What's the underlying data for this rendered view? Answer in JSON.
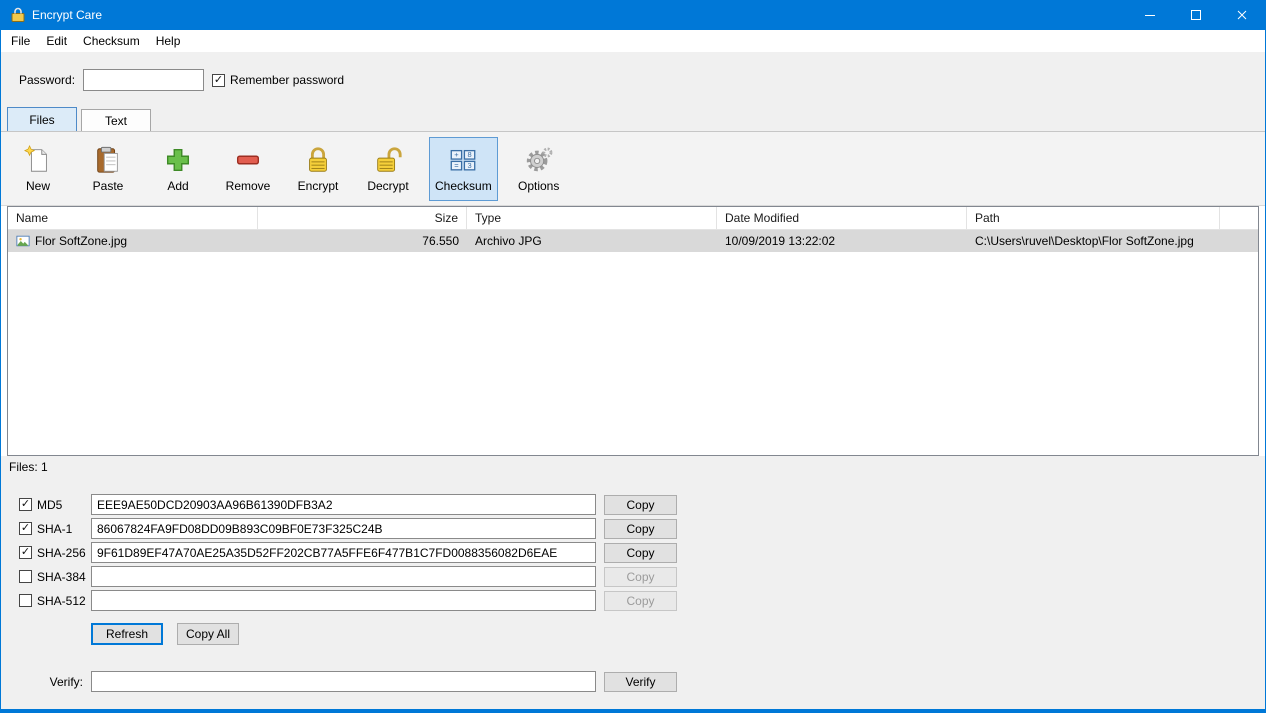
{
  "window": {
    "title": "Encrypt Care"
  },
  "menu": {
    "items": [
      "File",
      "Edit",
      "Checksum",
      "Help"
    ]
  },
  "password": {
    "label": "Password:",
    "value": "",
    "remember_label": "Remember password",
    "remember_checked": true
  },
  "tabs": [
    {
      "label": "Files",
      "active": true
    },
    {
      "label": "Text",
      "active": false
    }
  ],
  "toolbar": [
    {
      "label": "New",
      "icon": "new-document-icon",
      "selected": false
    },
    {
      "label": "Paste",
      "icon": "clipboard-paste-icon",
      "selected": false
    },
    {
      "label": "Add",
      "icon": "add-plus-icon",
      "selected": false
    },
    {
      "label": "Remove",
      "icon": "remove-minus-icon",
      "selected": false
    },
    {
      "label": "Encrypt",
      "icon": "lock-closed-icon",
      "selected": false
    },
    {
      "label": "Decrypt",
      "icon": "lock-open-icon",
      "selected": false
    },
    {
      "label": "Checksum",
      "icon": "checksum-grid-icon",
      "selected": true
    },
    {
      "label": "Options",
      "icon": "gear-icon",
      "selected": false
    }
  ],
  "file_table": {
    "columns": [
      "Name",
      "Size",
      "Type",
      "Date Modified",
      "Path"
    ],
    "rows": [
      {
        "name": "Flor SoftZone.jpg",
        "size": "76.550",
        "type": "Archivo JPG",
        "date_modified": "10/09/2019 13:22:02",
        "path": "C:\\Users\\ruvel\\Desktop\\Flor SoftZone.jpg"
      }
    ]
  },
  "status": {
    "files_label": "Files: 1"
  },
  "checksums": {
    "rows": [
      {
        "label": "MD5",
        "checked": true,
        "value": "EEE9AE50DCD20903AA96B61390DFB3A2",
        "copy_label": "Copy",
        "copy_enabled": true
      },
      {
        "label": "SHA-1",
        "checked": true,
        "value": "86067824FA9FD08DD09B893C09BF0E73F325C24B",
        "copy_label": "Copy",
        "copy_enabled": true
      },
      {
        "label": "SHA-256",
        "checked": true,
        "value": "9F61D89EF47A70AE25A35D52FF202CB77A5FFE6F477B1C7FD0088356082D6EAE",
        "copy_label": "Copy",
        "copy_enabled": true
      },
      {
        "label": "SHA-384",
        "checked": false,
        "value": "",
        "copy_label": "Copy",
        "copy_enabled": false
      },
      {
        "label": "SHA-512",
        "checked": false,
        "value": "",
        "copy_label": "Copy",
        "copy_enabled": false
      }
    ],
    "refresh_label": "Refresh",
    "copy_all_label": "Copy All"
  },
  "verify": {
    "label": "Verify:",
    "value": "",
    "button_label": "Verify"
  },
  "colors": {
    "titlebar": "#0078d7",
    "accent": "#0078d7",
    "selected_row": "#d9d9d9",
    "toolbar_selected_bg": "#cfe4f7",
    "toolbar_selected_border": "#5e9bd4"
  }
}
